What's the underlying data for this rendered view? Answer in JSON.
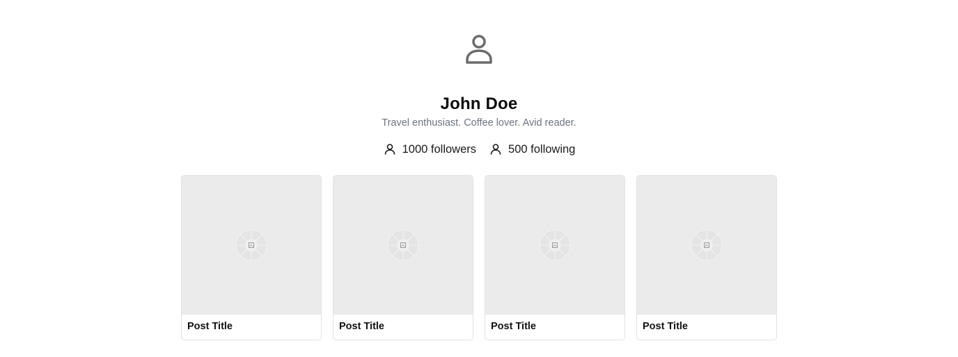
{
  "profile": {
    "avatar_icon": "user-icon",
    "name": "John Doe",
    "bio": "Travel enthusiast. Coffee lover. Avid reader."
  },
  "stats": {
    "followers_label": "1000 followers",
    "following_label": "500 following",
    "icon": "user-icon"
  },
  "posts": [
    {
      "title": "Post Title",
      "image_icon": "image-placeholder-icon"
    },
    {
      "title": "Post Title",
      "image_icon": "image-placeholder-icon"
    },
    {
      "title": "Post Title",
      "image_icon": "image-placeholder-icon"
    },
    {
      "title": "Post Title",
      "image_icon": "image-placeholder-icon"
    }
  ],
  "colors": {
    "text": "#111111",
    "muted": "#6b7280",
    "icon": "#6b6b6b",
    "thumb_bg": "#ebebeb",
    "border": "#e2e2e2"
  }
}
